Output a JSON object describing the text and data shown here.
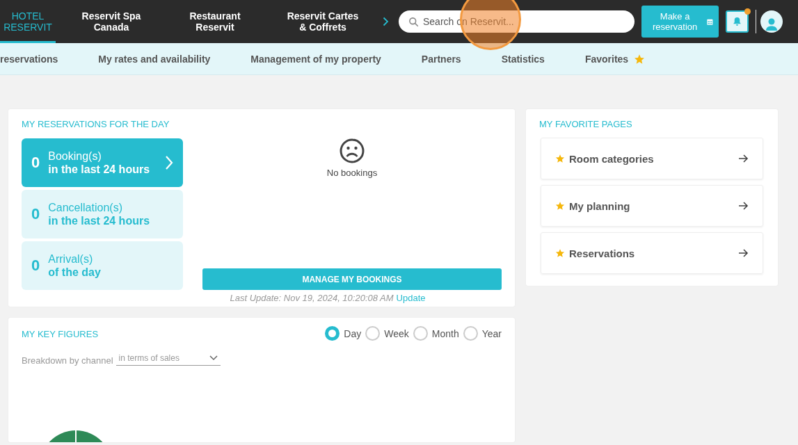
{
  "top_nav": {
    "tabs": [
      {
        "label": "HOTEL RESERVIT",
        "selected": true
      },
      {
        "label": "Reservit Spa Canada",
        "selected": false
      },
      {
        "label": "Restaurant Reservit",
        "selected": false
      },
      {
        "label": "Reservit Cartes & Coffrets",
        "selected": false
      }
    ],
    "search": {
      "placeholder": "Search on Reservit..."
    },
    "make_reservation_button": "Make a reservation",
    "notifications": {
      "unread": true
    }
  },
  "sub_nav": {
    "items": [
      {
        "label": "reservations",
        "starred": false
      },
      {
        "label": "My rates and availability",
        "starred": false
      },
      {
        "label": "Management of my property",
        "starred": false
      },
      {
        "label": "Partners",
        "starred": false
      },
      {
        "label": "Statistics",
        "starred": false
      },
      {
        "label": "Favorites",
        "starred": true
      }
    ]
  },
  "reservations_card": {
    "title": "MY RESERVATIONS FOR THE DAY",
    "tiles": [
      {
        "count": "0",
        "label": "Booking(s)",
        "sublabel": "in the last 24 hours",
        "selected": true
      },
      {
        "count": "0",
        "label": "Cancellation(s)",
        "sublabel": "in the last 24 hours",
        "selected": false
      },
      {
        "count": "0",
        "label": "Arrival(s)",
        "sublabel": "of the day",
        "selected": false
      }
    ],
    "empty_message": "No bookings",
    "button": "MANAGE MY BOOKINGS",
    "last_update": "Last Update: Nov 19, 2024, 10:20:08 AM",
    "update_link": "Update"
  },
  "key_figures": {
    "title": "MY KEY FIGURES",
    "periods": [
      {
        "label": "Day",
        "selected": true
      },
      {
        "label": "Week",
        "selected": false
      },
      {
        "label": "Month",
        "selected": false
      },
      {
        "label": "Year",
        "selected": false
      }
    ],
    "breakdown_label": "Breakdown by channel",
    "breakdown_select": "in terms of sales"
  },
  "favorites_card": {
    "title": "MY FAVORITE PAGES",
    "items": [
      {
        "label": "Room categories"
      },
      {
        "label": "My planning"
      },
      {
        "label": "Reservations"
      }
    ]
  }
}
